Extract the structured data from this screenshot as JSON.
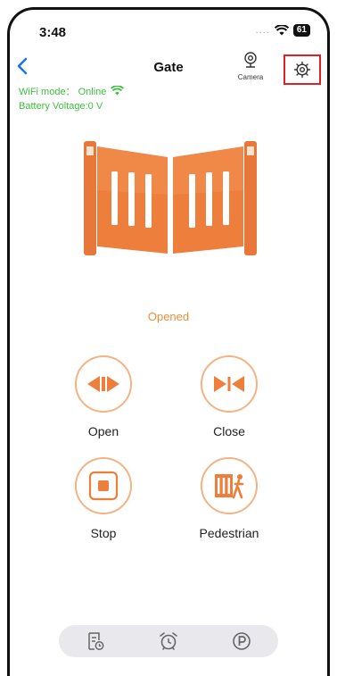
{
  "status_bar": {
    "time": "3:48",
    "signal": "....",
    "battery": "61"
  },
  "nav": {
    "title": "Gate",
    "camera_label": "Camera"
  },
  "info": {
    "wifi_mode": "WiFi mode： Online",
    "battery_voltage": "Battery Voltage:0 V"
  },
  "gate": {
    "state": "Opened"
  },
  "controls": [
    {
      "label": "Open",
      "icon": "open-arrows-icon"
    },
    {
      "label": "Close",
      "icon": "close-arrows-icon"
    },
    {
      "label": "Stop",
      "icon": "stop-square-icon"
    },
    {
      "label": "Pedestrian",
      "icon": "pedestrian-icon"
    }
  ],
  "tabbar": {
    "icons": [
      "log-icon",
      "alarm-clock-icon",
      "parking-icon"
    ]
  },
  "colors": {
    "accent": "#f08c35",
    "online": "#3fbf3f",
    "highlight": "#e02020",
    "back": "#1a73e8"
  }
}
